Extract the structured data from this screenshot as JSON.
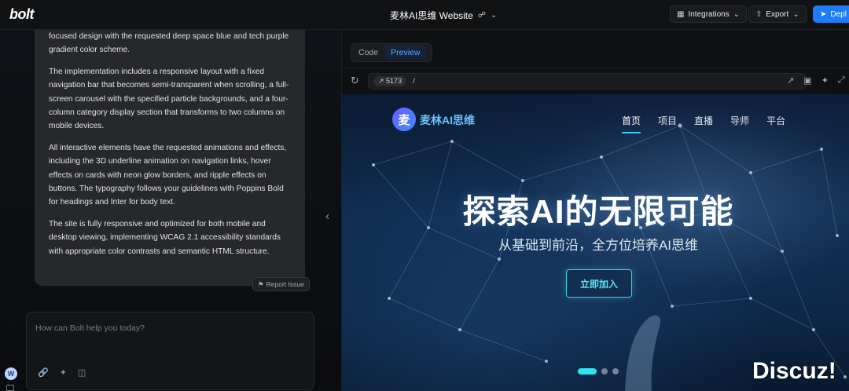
{
  "topbar": {
    "logo": "bolt",
    "project_title": "麦林AI思维 Website",
    "integrations_label": "Integrations",
    "export_label": "Export",
    "deploy_label": "Depl"
  },
  "chat": {
    "paragraphs": [
      "focused design with the requested deep space blue and tech purple gradient color scheme.",
      "The implementation includes a responsive layout with a fixed navigation bar that becomes semi-transparent when scrolling, a full-screen carousel with the specified particle backgrounds, and a four-column category display section that transforms to two columns on mobile devices.",
      "All interactive elements have the requested animations and effects, including the 3D underline animation on navigation links, hover effects on cards with neon glow borders, and ripple effects on buttons. The typography follows your guidelines with Poppins Bold for headings and Inter for body text.",
      "The site is fully responsive and optimized for both mobile and desktop viewing, implementing WCAG 2.1 accessibility standards with appropriate color contrasts and semantic HTML structure."
    ],
    "report_label": "Report Issue",
    "composer_placeholder": "How can Bolt help you today?",
    "avatar_initial": "W"
  },
  "workbench": {
    "tabs": [
      {
        "label": "Code"
      },
      {
        "label": "Preview"
      }
    ],
    "port": "5173",
    "path": "/"
  },
  "site": {
    "logo_char": "麦",
    "name": "麦林AI思维",
    "nav": [
      "首页",
      "项目",
      "直播",
      "导师",
      "平台"
    ],
    "hero_title": "探索AI的无限可能",
    "hero_subtitle": "从基础到前沿，全方位培养AI思维",
    "cta_label": "立即加入",
    "carousel_active_index": 0,
    "carousel_count": 3
  },
  "watermark": "Discuz!"
}
